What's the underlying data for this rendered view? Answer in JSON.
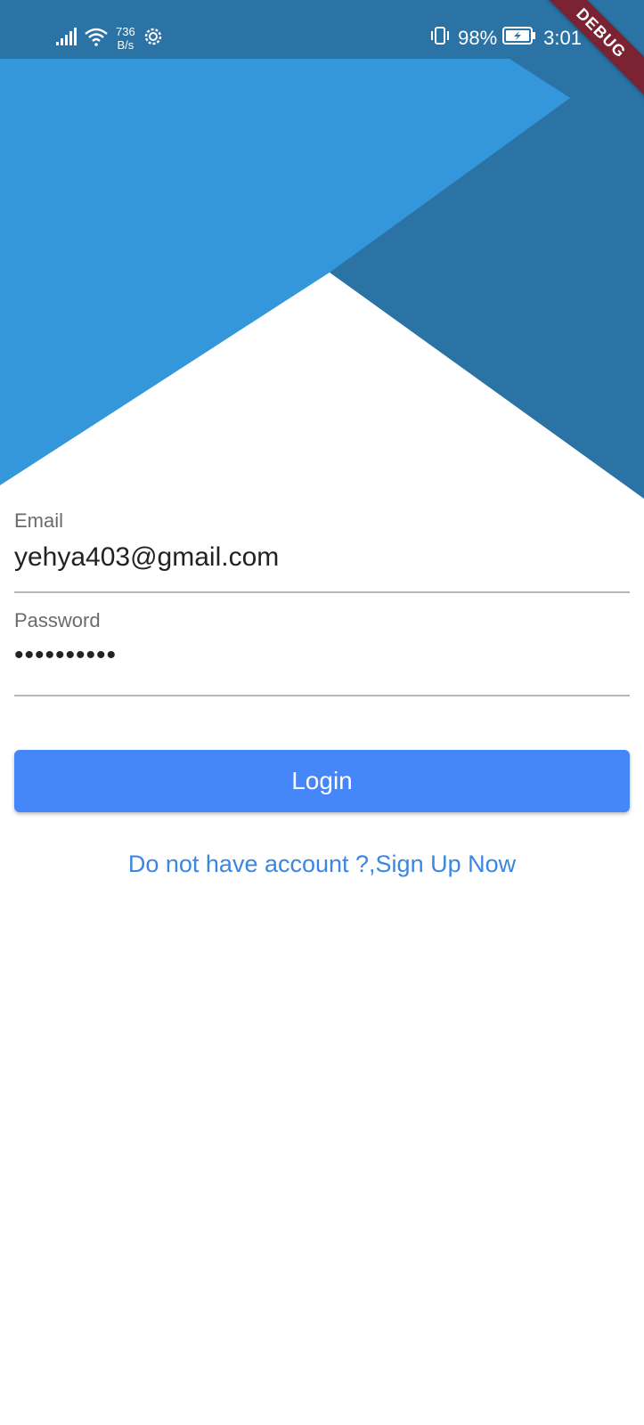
{
  "status_bar": {
    "net_speed_value": "736",
    "net_speed_unit": "B/s",
    "battery_percent": "98%",
    "time": "3:01"
  },
  "debug_banner": {
    "label": "DEBUG"
  },
  "login_form": {
    "email_label": "Email",
    "email_value": "yehya403@gmail.com",
    "password_label": "Password",
    "password_value": "••••••••••",
    "login_button_label": "Login",
    "signup_link_text": "Do not have account ?,Sign Up Now"
  },
  "colors": {
    "primary": "#4586f8",
    "header_light": "#3597db",
    "header_dark": "#2b73a5",
    "link": "#3b86e3"
  },
  "icons": {
    "signal": "signal-icon",
    "wifi": "wifi-icon",
    "settings": "gear-icon",
    "vibrate": "vibrate-icon",
    "battery": "battery-charging-icon"
  }
}
